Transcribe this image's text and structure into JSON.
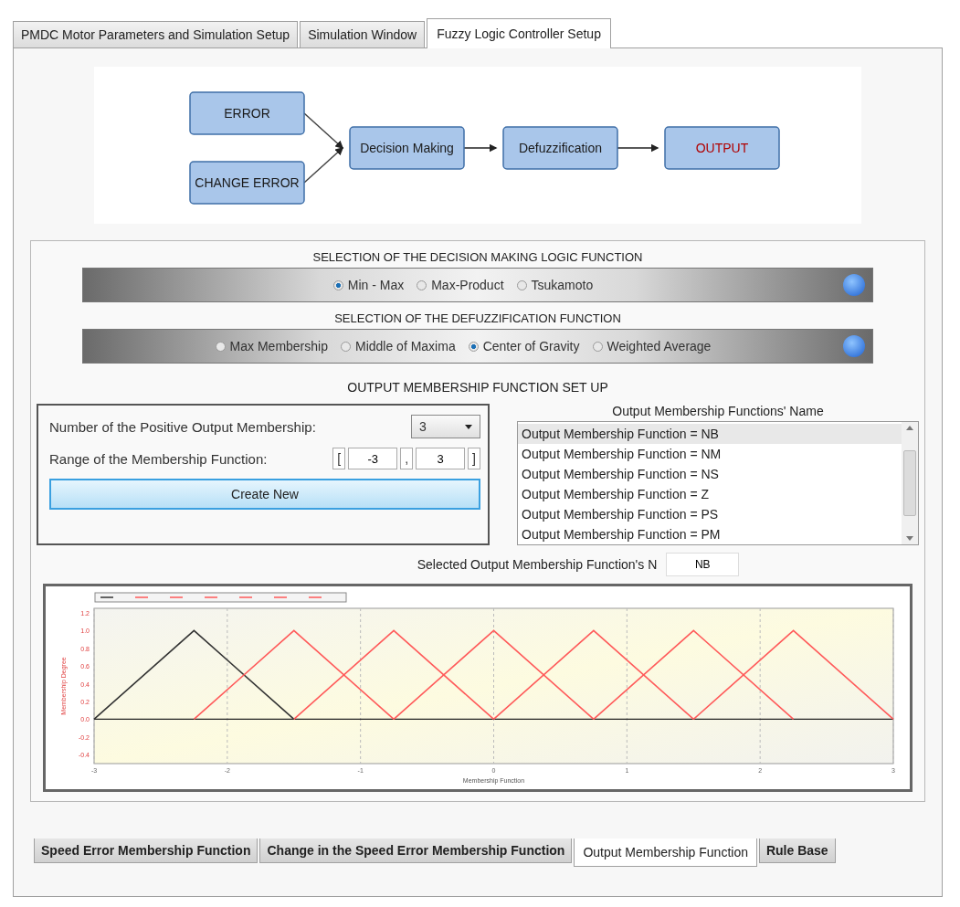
{
  "tabs": [
    {
      "label": "PMDC Motor Parameters and Simulation Setup",
      "selected": false
    },
    {
      "label": "Simulation Window",
      "selected": false
    },
    {
      "label": "Fuzzy Logic Controller Setup",
      "selected": true
    }
  ],
  "diagram": {
    "nodes": [
      {
        "label": "ERROR",
        "color": "#1a1a1a"
      },
      {
        "label": "CHANGE ERROR",
        "color": "#1a1a1a"
      },
      {
        "label": "Decision Making",
        "color": "#1a1a1a"
      },
      {
        "label": "Defuzzification",
        "color": "#1a1a1a"
      },
      {
        "label": "OUTPUT",
        "color": "#b00000"
      }
    ]
  },
  "decision": {
    "heading": "SELECTION OF THE DECISION MAKING LOGIC FUNCTION",
    "options": [
      {
        "label": "Min - Max",
        "selected": true
      },
      {
        "label": "Max-Product",
        "selected": false
      },
      {
        "label": "Tsukamoto",
        "selected": false
      }
    ]
  },
  "defuzzification": {
    "heading": "SELECTION OF THE DEFUZZIFICATION FUNCTION",
    "options": [
      {
        "label": "Max Membership",
        "selected": false
      },
      {
        "label": "Middle of Maxima",
        "selected": false
      },
      {
        "label": "Center of Gravity",
        "selected": true
      },
      {
        "label": "Weighted Average",
        "selected": false
      }
    ]
  },
  "output_setup": {
    "heading": "OUTPUT MEMBERSHIP FUNCTION SET UP",
    "count_label": "Number of the Positive Output Membership:",
    "count_value": "3",
    "range_label": "Range of the Membership Function:",
    "range_open": "[",
    "range_min": "-3",
    "range_sep": ",",
    "range_max": "3",
    "range_close": "]",
    "create_button": "Create New",
    "list_heading": "Output Membership Functions' Name",
    "list_items": [
      {
        "label": "Output Membership Function = NB",
        "selected": true
      },
      {
        "label": "Output Membership Function = NM",
        "selected": false
      },
      {
        "label": "Output Membership Function = NS",
        "selected": false
      },
      {
        "label": "Output Membership Function = Z",
        "selected": false
      },
      {
        "label": "Output Membership Function = PS",
        "selected": false
      },
      {
        "label": "Output Membership Function = PM",
        "selected": false
      }
    ],
    "selected_label": "Selected Output Membership Function's N",
    "selected_value": "NB"
  },
  "chart_data": {
    "type": "line",
    "xlabel": "Membership Function",
    "ylabel": "Membership Degree",
    "x": [
      -3,
      -2.25,
      -1.5,
      -0.75,
      0,
      0.75,
      1.5,
      2.25,
      3
    ],
    "xlim": [
      -3,
      3
    ],
    "ylim": [
      -0.5,
      1.25
    ],
    "xticks": [
      -3,
      -2,
      -1,
      0,
      1,
      2,
      3
    ],
    "yticks": [
      1.2,
      {
        "value": 1,
        "label": "1.0"
      },
      0.8,
      0.6,
      0.4,
      0.2,
      {
        "value": 0,
        "label": "0.0"
      },
      -0.2,
      -0.4
    ],
    "grid": true,
    "series": [
      {
        "color": "#333333",
        "values": [
          0,
          1,
          0,
          null,
          null,
          null,
          null,
          null,
          null
        ]
      },
      {
        "color": "#ff5a5a",
        "values": [
          null,
          0,
          1,
          0,
          null,
          null,
          null,
          null,
          null
        ]
      },
      {
        "color": "#ff5a5a",
        "values": [
          null,
          null,
          0,
          1,
          0,
          null,
          null,
          null,
          null
        ]
      },
      {
        "color": "#ff5a5a",
        "values": [
          null,
          null,
          null,
          0,
          1,
          0,
          null,
          null,
          null
        ]
      },
      {
        "color": "#ff5a5a",
        "values": [
          null,
          null,
          null,
          null,
          0,
          1,
          0,
          null,
          null
        ]
      },
      {
        "color": "#ff5a5a",
        "values": [
          null,
          null,
          null,
          null,
          null,
          0,
          1,
          0,
          null
        ]
      },
      {
        "color": "#ff5a5a",
        "values": [
          null,
          null,
          null,
          null,
          null,
          null,
          0,
          1,
          0
        ]
      }
    ]
  },
  "bottom_tabs": [
    {
      "label": "Speed Error Membership Function",
      "selected": false
    },
    {
      "label": "Change in the Speed Error Membership Function",
      "selected": false
    },
    {
      "label": "Output Membership Function",
      "selected": true
    },
    {
      "label": "Rule Base",
      "selected": false
    }
  ]
}
